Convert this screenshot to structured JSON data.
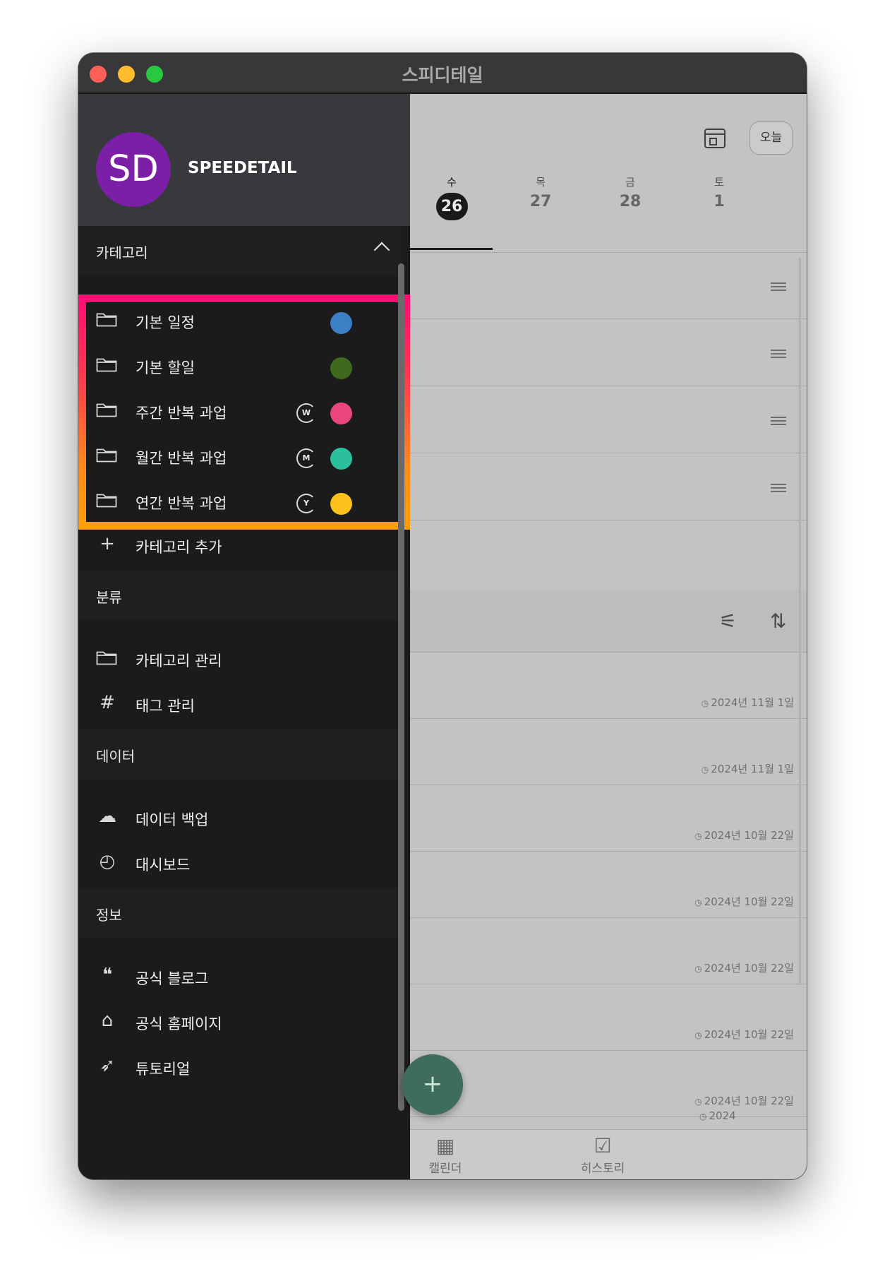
{
  "window": {
    "title": "스피디테일"
  },
  "profile": {
    "initials": "SD",
    "name": "SPEEDETAIL"
  },
  "sidebar": {
    "categories_header": "카테고리",
    "categories": [
      {
        "label": "기본 일정",
        "color": "#3b7fc4",
        "repeat": ""
      },
      {
        "label": "기본 할일",
        "color": "#3f6a1e",
        "repeat": ""
      },
      {
        "label": "주간 반복 과업",
        "color": "#e9467c",
        "repeat": "W"
      },
      {
        "label": "월간 반복 과업",
        "color": "#2bbf9c",
        "repeat": "M"
      },
      {
        "label": "연간 반복 과업",
        "color": "#fcc21b",
        "repeat": "Y"
      }
    ],
    "add_category": "카테고리 추가",
    "classify_header": "분류",
    "classify": [
      {
        "label": "카테고리 관리",
        "icon": "folder-icon"
      },
      {
        "label": "태그 관리",
        "icon": "hashtag-icon"
      }
    ],
    "data_header": "데이터",
    "data": [
      {
        "label": "데이터 백업",
        "icon": "cloud-icon"
      },
      {
        "label": "대시보드",
        "icon": "pie-chart-icon"
      }
    ],
    "info_header": "정보",
    "info": [
      {
        "label": "공식 블로그",
        "icon": "quote-bubble-icon"
      },
      {
        "label": "공식 홈페이지",
        "icon": "home-icon"
      },
      {
        "label": "튜토리얼",
        "icon": "rocket-icon"
      }
    ]
  },
  "main": {
    "today_button": "오늘",
    "days": [
      {
        "dow": "수",
        "num": "26",
        "selected": true
      },
      {
        "dow": "목",
        "num": "27",
        "selected": false
      },
      {
        "dow": "금",
        "num": "28",
        "selected": false
      },
      {
        "dow": "토",
        "num": "1",
        "selected": false
      }
    ],
    "history_dates": [
      "2024년 11월 1일",
      "2024년 11월 1일",
      "2024년 10월 22일",
      "2024년 10월 22일",
      "2024년 10월 22일",
      "2024년 10월 22일",
      "2024년 10월 22일",
      "2024"
    ],
    "bottom_nav": {
      "calendar": "캘린더",
      "history": "히스토리"
    },
    "fab_icon": "plus-icon"
  },
  "colors": {
    "highlight_top": "#ff0f72",
    "highlight_bottom": "#ff9d0a",
    "fab": "#3f6d5b",
    "avatar": "#7a1fa6"
  }
}
